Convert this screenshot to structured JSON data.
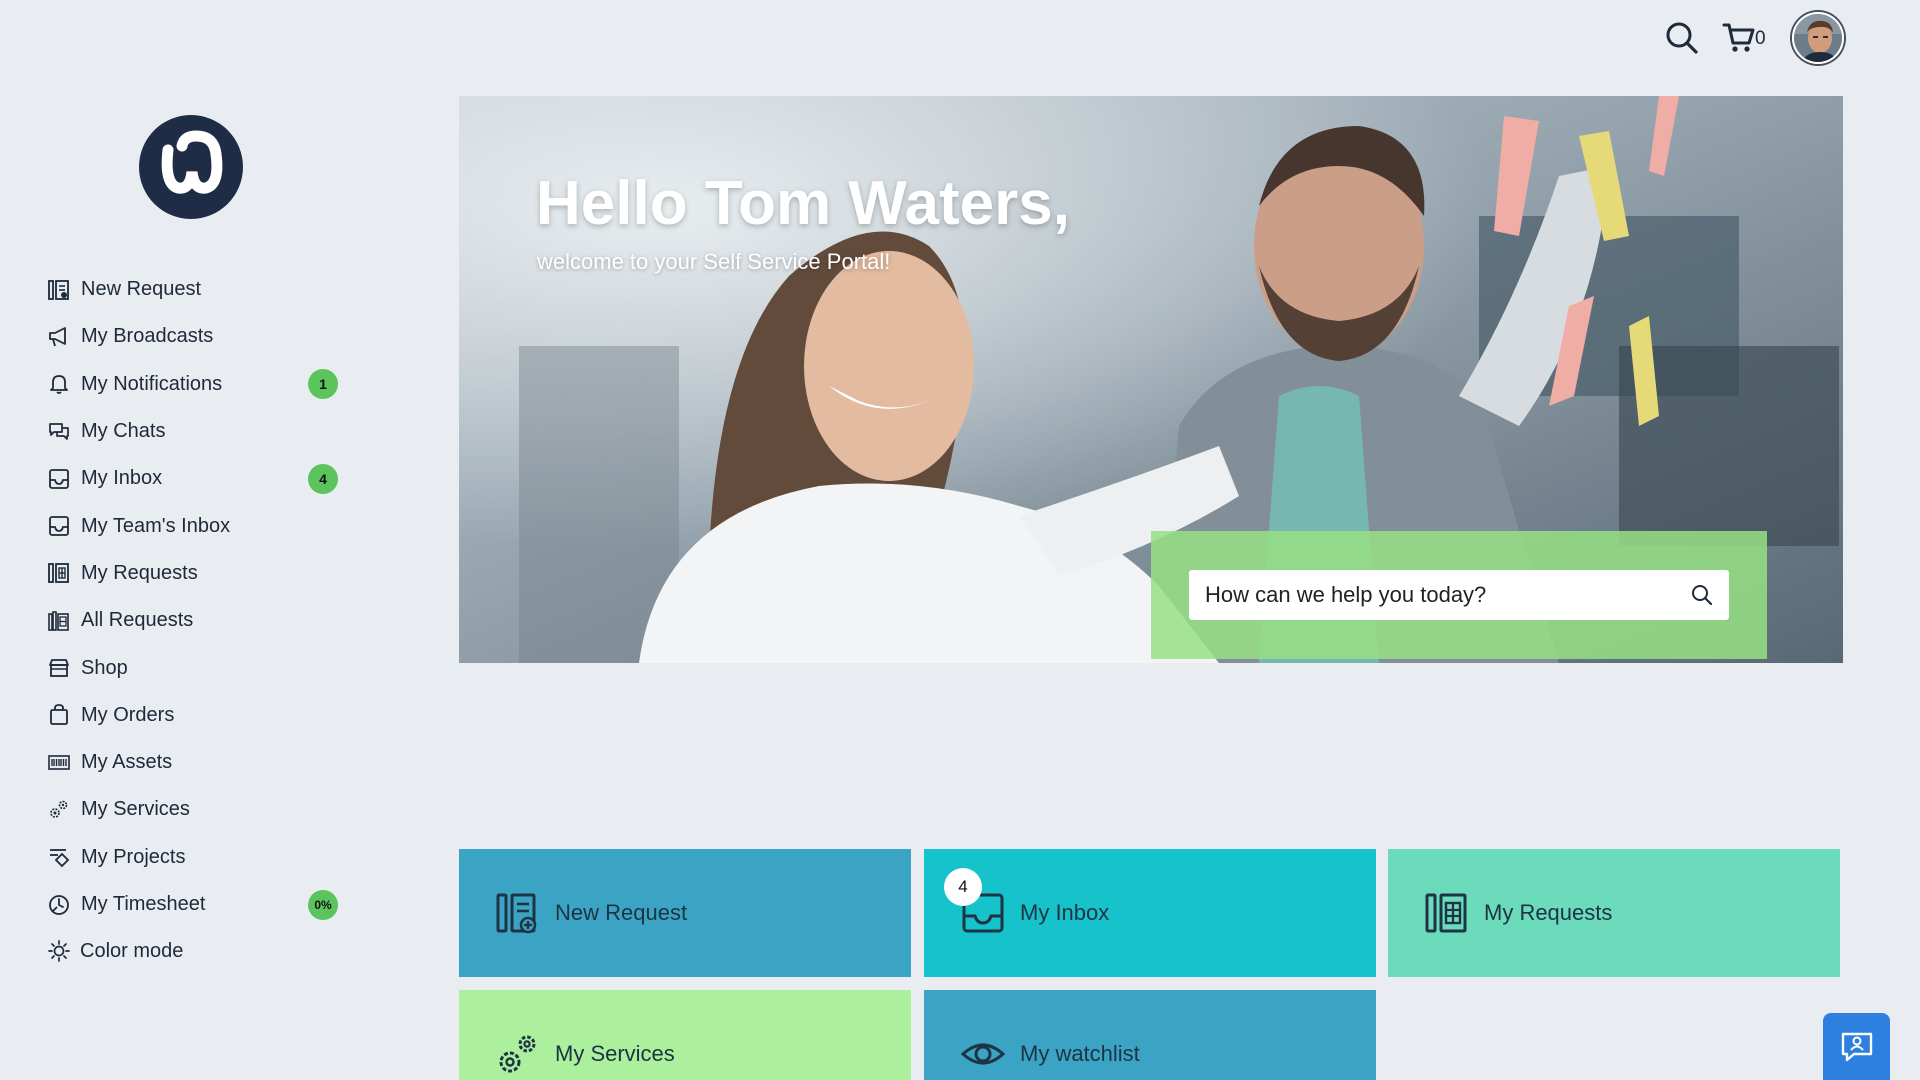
{
  "header": {
    "search_icon": "search-icon",
    "cart_icon": "cart-icon",
    "cart_count": "0"
  },
  "sidebar": {
    "items": [
      {
        "label": "New Request",
        "icon": "new-request-icon",
        "badge": null
      },
      {
        "label": "My Broadcasts",
        "icon": "megaphone-icon",
        "badge": null
      },
      {
        "label": "My Notifications",
        "icon": "bell-icon",
        "badge": "1"
      },
      {
        "label": "My Chats",
        "icon": "chat-icon",
        "badge": null
      },
      {
        "label": "My Inbox",
        "icon": "inbox-icon",
        "badge": "4"
      },
      {
        "label": "My Team's Inbox",
        "icon": "inbox-icon",
        "badge": null
      },
      {
        "label": "My Requests",
        "icon": "requests-icon",
        "badge": null
      },
      {
        "label": "All Requests",
        "icon": "all-requests-icon",
        "badge": null
      },
      {
        "label": "Shop",
        "icon": "shop-icon",
        "badge": null
      },
      {
        "label": "My Orders",
        "icon": "bag-icon",
        "badge": null
      },
      {
        "label": "My Assets",
        "icon": "barcode-icon",
        "badge": null
      },
      {
        "label": "My Services",
        "icon": "gears-icon",
        "badge": null
      },
      {
        "label": "My Projects",
        "icon": "projects-icon",
        "badge": null
      },
      {
        "label": "My Timesheet",
        "icon": "timesheet-icon",
        "badge": "0%"
      }
    ],
    "color_mode": "Color mode"
  },
  "hero": {
    "title": "Hello Tom Waters,",
    "subtitle": "welcome to your Self Service Portal!",
    "search_placeholder": "How can we help you today?"
  },
  "tiles": [
    {
      "label": "New Request",
      "icon": "new-request-icon",
      "color": "#3ba4c4",
      "badge": null
    },
    {
      "label": "My Inbox",
      "icon": "inbox-icon",
      "color": "#17c3cb",
      "badge": "4"
    },
    {
      "label": "My Requests",
      "icon": "requests-icon",
      "color": "#6bdbbc",
      "badge": null
    },
    {
      "label": "My Services",
      "icon": "gears-icon",
      "color": "#acef9c",
      "badge": null
    },
    {
      "label": "My watchlist",
      "icon": "eye-icon",
      "color": "#3ba4c4",
      "badge": null
    }
  ],
  "colors": {
    "background": "#e9ecf0",
    "badge_green": "#5cc45c",
    "chat_button": "#2d7fe0",
    "logo": "#1e2d45"
  }
}
